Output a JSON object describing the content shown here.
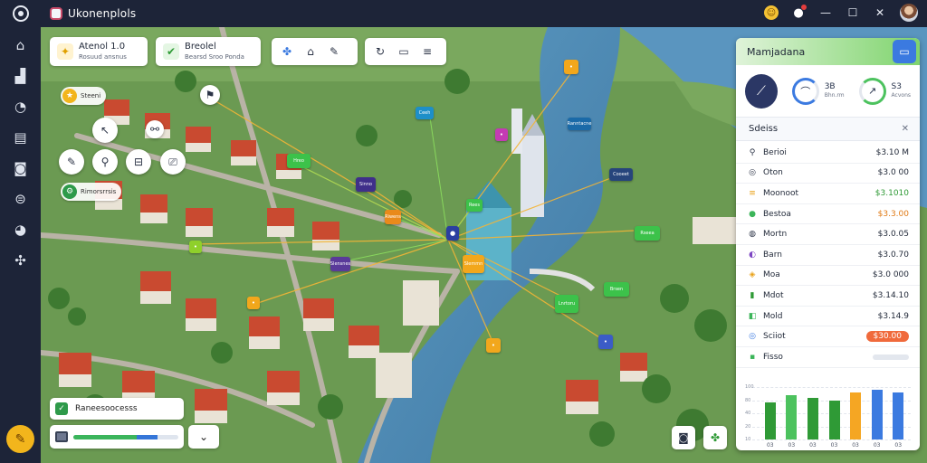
{
  "app": {
    "title": "Ukonenplols"
  },
  "sidebar": {
    "items": [
      "home-icon",
      "chart-icon",
      "chat-icon",
      "calendar-icon",
      "camera-icon",
      "download-icon",
      "eye-icon",
      "tools-icon"
    ]
  },
  "topbar": {
    "emoji": "☺",
    "icons": [
      "bell-icon",
      "minimize-icon",
      "maximize-icon",
      "close-icon"
    ]
  },
  "cards": [
    {
      "title": "Atenol 1.0",
      "subtitle": "Rosuud ansnus",
      "icon_color": "#f5b400"
    },
    {
      "title": "Breolel",
      "subtitle": "Bearsd Sroo Ponda",
      "icon_color": "#3cb55a"
    }
  ],
  "pill_labels": [
    {
      "text": "Steeni",
      "color": "#f2b51c"
    },
    {
      "text": "Rimorsrrsis",
      "color": "#2e9a4a"
    }
  ],
  "markers": [
    "Ceeh",
    "Ranntacne",
    "Hreo",
    "Sinno",
    "Cooeet",
    "Rees",
    "Riwens",
    "Rseea",
    "Slensnes",
    "Slemmn",
    "Brsen",
    "Lnrtoru"
  ],
  "bottom": {
    "progress_label": "Raneesoocesss",
    "slider": {
      "green": 0.6,
      "blue": 0.2
    }
  },
  "panel": {
    "title": "Mamjadana",
    "kpis": [
      {
        "value": "3B",
        "sub": "Bhn.rm",
        "ring": "#3b7ae0"
      },
      {
        "value": "S3",
        "sub": "Acvons",
        "ring": "#4cc25e"
      }
    ],
    "section_title": "Sdeiss",
    "rows": [
      {
        "icon": "⚲",
        "name": "Berioi",
        "value": "$3.10 M",
        "color": "#2b3346"
      },
      {
        "icon": "◎",
        "name": "Oton",
        "value": "$3.0 00",
        "color": "#2b3346"
      },
      {
        "icon": "≡",
        "name": "Moonoot",
        "value": "$3.1010",
        "color": "#e9a21a",
        "val_color": "#2f9a36"
      },
      {
        "icon": "●",
        "name": "Bestoa",
        "value": "$3.3.00",
        "color": "#3cb55a",
        "val_color": "#e07a15"
      },
      {
        "icon": "◍",
        "name": "Mortn",
        "value": "$3.0.05",
        "color": "#2b3346"
      },
      {
        "icon": "◐",
        "name": "Barn",
        "value": "$3.0.70",
        "color": "#7c45c2"
      },
      {
        "icon": "◈",
        "name": "Moa",
        "value": "$3.0 000",
        "color": "#e9a21a"
      },
      {
        "icon": "▮",
        "name": "Mdot",
        "value": "$3.14.10",
        "color": "#2f9a36"
      },
      {
        "icon": "◧",
        "name": "Mold",
        "value": "$3.14.9",
        "color": "#3cb55a"
      },
      {
        "icon": "◎",
        "name": "Sciiot",
        "value": "$30.00",
        "color": "#3b7ae0",
        "pill": "#f06a3c"
      },
      {
        "icon": "▪",
        "name": "Fisso",
        "value": "",
        "color": "#3cb55a",
        "track": true
      }
    ],
    "chart_data": {
      "type": "bar",
      "categories": [
        "03",
        "03",
        "03",
        "03",
        "03",
        "03",
        "03"
      ],
      "series": [
        {
          "values": [
            0.7,
            0.85,
            0.8,
            0.75,
            0.9,
            0.95,
            0.9
          ]
        }
      ],
      "colors": [
        "#2f9a36",
        "#4cc25e",
        "#2f9a36",
        "#2f9a36",
        "#f5a623",
        "#3b7ae0",
        "#3b7ae0"
      ],
      "yticks": [
        "100",
        "80",
        "40",
        "20",
        "10"
      ],
      "ylim": [
        0,
        1
      ]
    }
  }
}
